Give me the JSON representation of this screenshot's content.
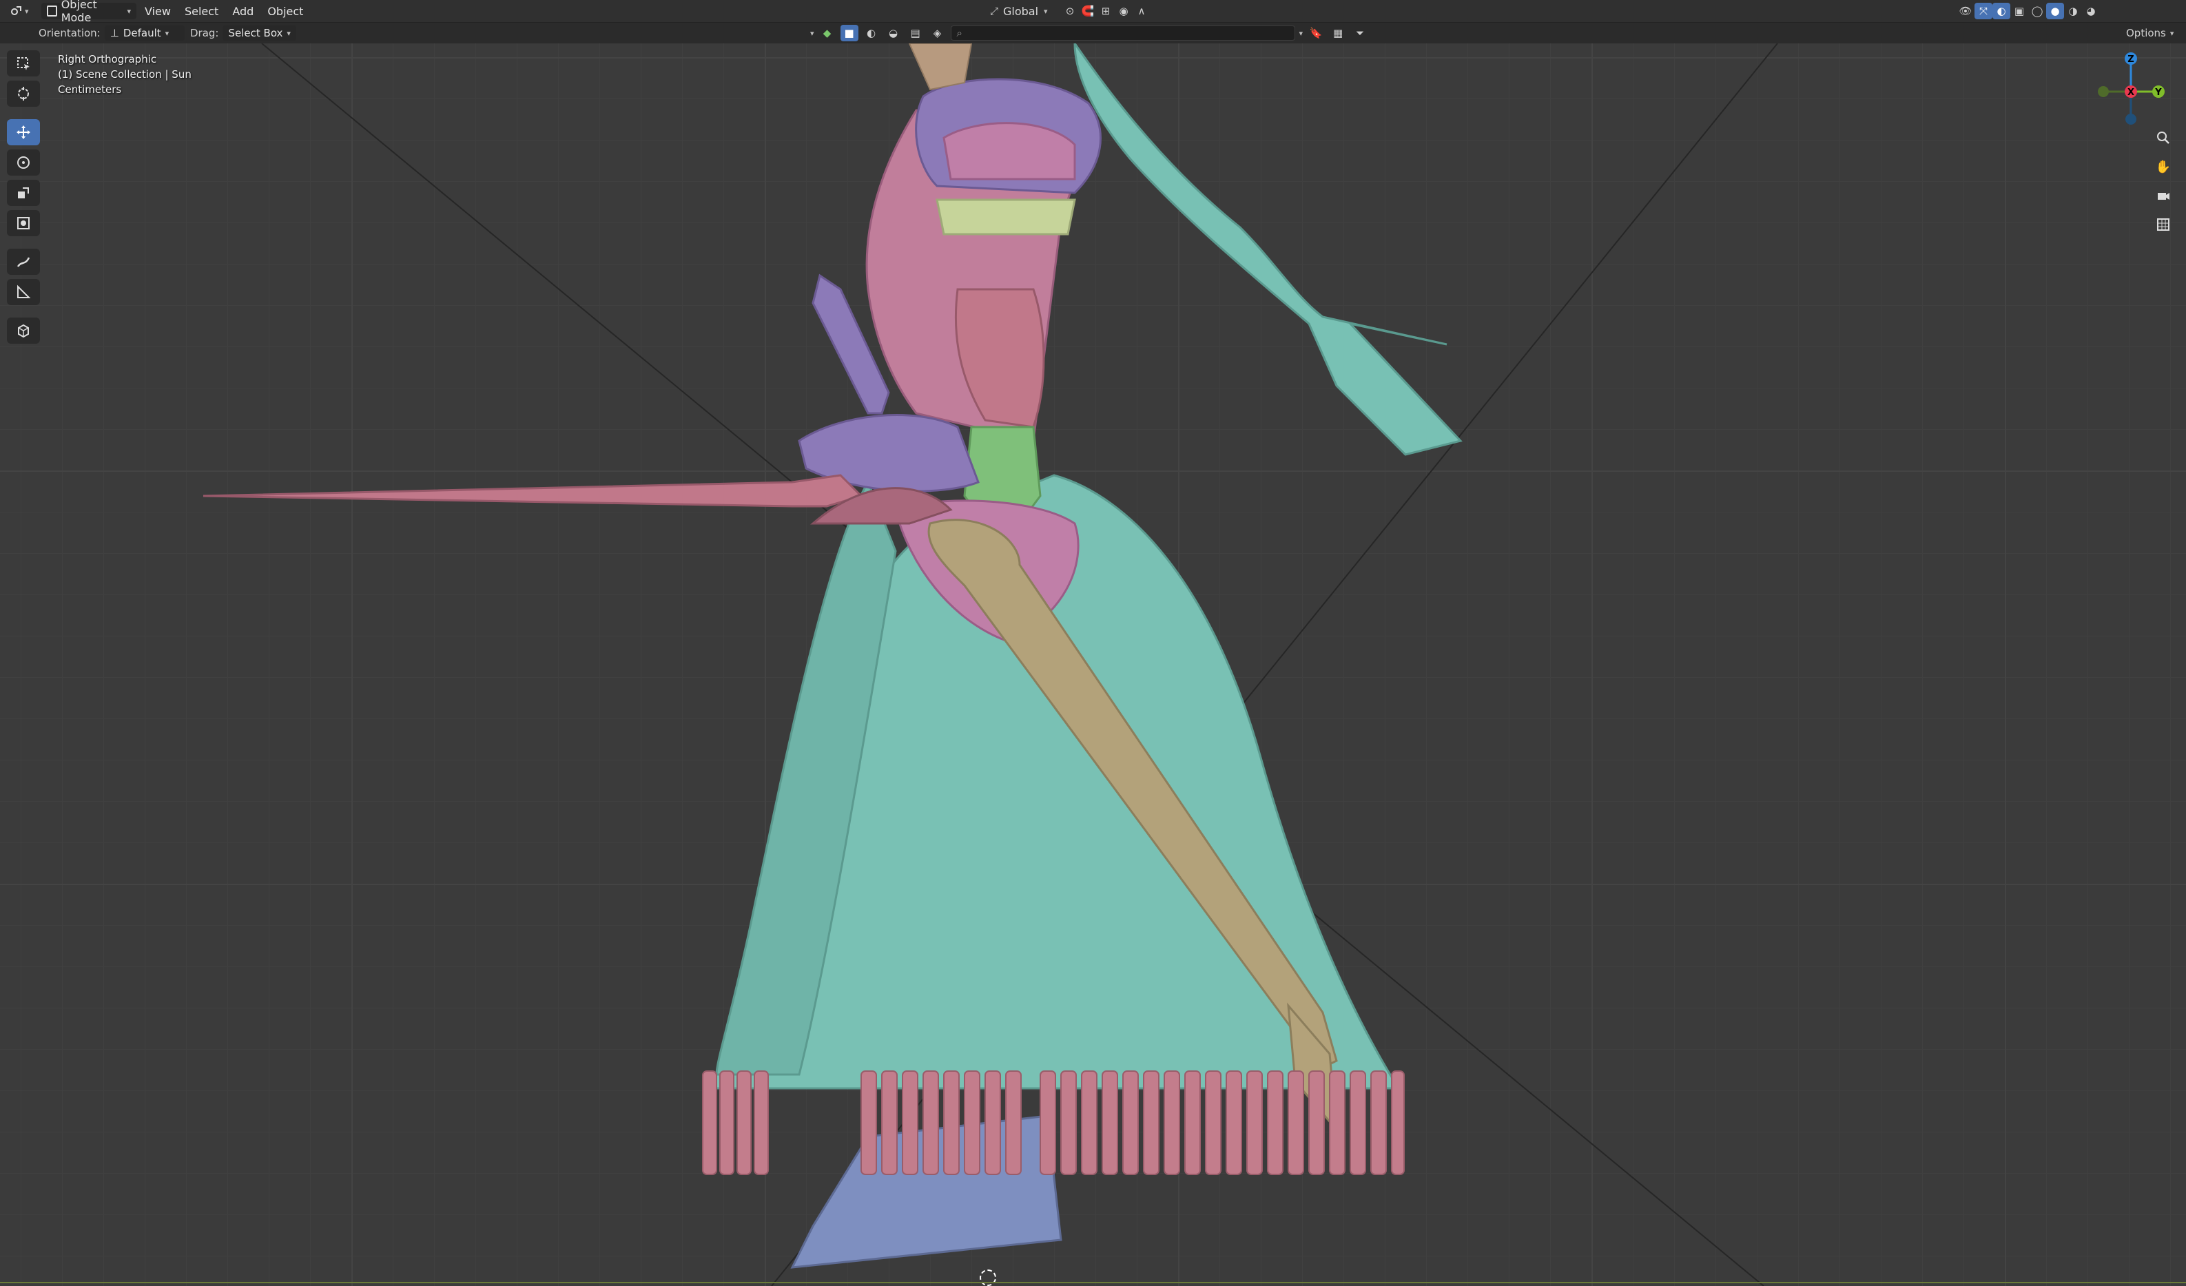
{
  "header": {
    "editor_type_icon": "3d-viewport-icon",
    "mode": "Object Mode",
    "menus": [
      "View",
      "Select",
      "Add",
      "Object"
    ],
    "transform_orientation": "Global",
    "options_label": "Options"
  },
  "tool_settings": {
    "orientation_label": "Orientation:",
    "orientation_value": "Default",
    "drag_label": "Drag:",
    "drag_value": "Select Box"
  },
  "viewport": {
    "view_name": "Right Orthographic",
    "collection_info": "(1) Scene Collection | Sun",
    "units": "Centimeters"
  },
  "gizmo": {
    "axes": [
      "Z",
      "X",
      "Y"
    ],
    "colors": {
      "x": "#e8394f",
      "y": "#80bd2a",
      "z": "#2e88dd"
    }
  },
  "tools": [
    "select-box-icon",
    "cursor-icon",
    "move-icon",
    "rotate-icon",
    "scale-icon",
    "transform-icon",
    "annotate-icon",
    "measure-icon",
    "add-cube-icon"
  ],
  "colors": {
    "accent": "#4772b3",
    "dress": "#79c1b4",
    "pink": "#c37d8c",
    "sword": "#b3a27a",
    "purple": "#8c7ab8",
    "blue_grey": "#7e8fc0"
  }
}
